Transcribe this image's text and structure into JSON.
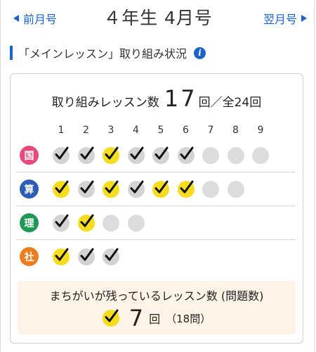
{
  "header": {
    "prev_label": "前月号",
    "title": "４年生 4月号",
    "next_label": "翌月号"
  },
  "section": {
    "title": "「メインレッスン」取り組み状況",
    "info_icon": "i"
  },
  "summary": {
    "label": "取り組みレッスン数",
    "count": "17",
    "unit": "回",
    "separator": "／",
    "total": "全24回"
  },
  "lesson_numbers": [
    "1",
    "2",
    "3",
    "4",
    "5",
    "6",
    "7",
    "8",
    "9"
  ],
  "legend_states": {
    "perfect": "yellow circle with check",
    "done": "gray circle with check",
    "empty": "gray circle"
  },
  "subjects": [
    {
      "label": "国",
      "color": "#e8487a",
      "lessons": [
        "done",
        "done",
        "perfect",
        "done",
        "done",
        "done",
        "empty",
        "empty",
        "empty"
      ]
    },
    {
      "label": "算",
      "color": "#2b5cb8",
      "lessons": [
        "perfect",
        "done",
        "perfect",
        "done",
        "perfect",
        "perfect",
        "empty",
        "empty"
      ]
    },
    {
      "label": "理",
      "color": "#1e9a55",
      "lessons": [
        "done",
        "perfect",
        "empty",
        "empty"
      ]
    },
    {
      "label": "社",
      "color": "#ee7d1e",
      "lessons": [
        "perfect",
        "done",
        "done"
      ]
    }
  ],
  "mistakes": {
    "title": "まちがいが残っているレッスン数 (問題数)",
    "count": "7",
    "unit": "回",
    "questions": "（18問）"
  },
  "colors": {
    "accent_blue": "#1a63c9",
    "perfect_yellow": "#f5dd1d",
    "done_gray": "#d3d3d3",
    "empty_gray": "#dcdcdc",
    "mistakes_bg": "#fdf3e6"
  }
}
